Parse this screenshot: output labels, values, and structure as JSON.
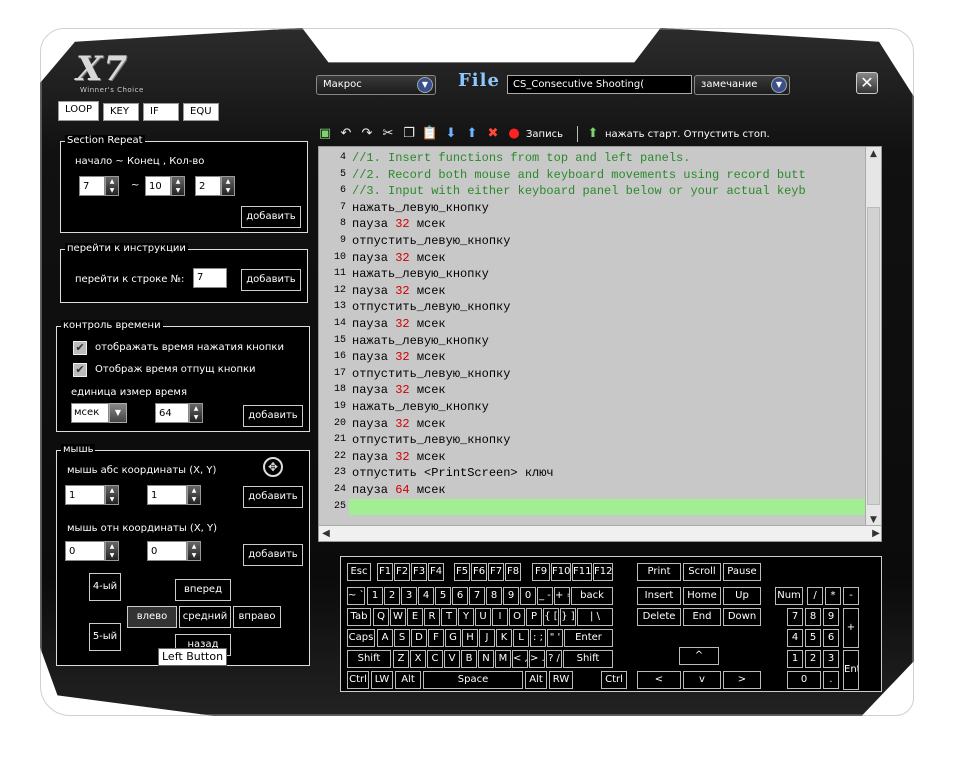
{
  "logo": {
    "mark": "X7",
    "sub": "Winner's Choice"
  },
  "top": {
    "mode_select": "Макрос",
    "file_label": "File",
    "file_name": "CS_Consecutive Shooting(",
    "delay_select": "замечание",
    "close": "✕"
  },
  "tabs": [
    "LOOP",
    "KEY",
    "IF",
    "EQU"
  ],
  "section_repeat": {
    "title": "Section Repeat",
    "hint": "начало ~ Конец , Кол-во",
    "start": "7",
    "tilde": "~",
    "end": "10",
    "count": "2",
    "add": "добавить"
  },
  "goto": {
    "title": "перейти к инструкции",
    "label": "перейти к строке №:",
    "value": "7",
    "add": "добавить"
  },
  "time_control": {
    "title": "контроль времени",
    "opt1": "отображать время нажатия кнопки",
    "opt2": "Отображ время отпущ кнопки",
    "unit_label": "единица измер",
    "time_label": "время",
    "unit": "мсек",
    "time": "64",
    "add": "добавить"
  },
  "mouse": {
    "title": "мышь",
    "abs_label": "мышь абс координаты (X, Y)",
    "abs_x": "1",
    "abs_y": "1",
    "rel_label": "мышь отн координаты (X, Y)",
    "rel_x": "0",
    "rel_y": "0",
    "add": "добавить",
    "btn4": "4-ый",
    "btn5": "5-ый",
    "forward": "вперед",
    "left": "влево",
    "middle": "средний",
    "right": "вправо",
    "back": "назад",
    "tooltip": "Left Button"
  },
  "toolbar": {
    "record": "Запись",
    "hint": "нажать старт. Отпустить стоп."
  },
  "editor": {
    "lines": [
      {
        "num": "4",
        "code": "//1. Insert functions from top and left panels.",
        "type": "comment"
      },
      {
        "num": "5",
        "code": "//2. Record both mouse and keyboard movements using record butt",
        "type": "comment"
      },
      {
        "num": "6",
        "code": "//3. Input with either keyboard panel below or your actual keyb",
        "type": "comment"
      },
      {
        "num": "7",
        "code": "нажать_левую_кнопку",
        "type": "cmd"
      },
      {
        "num": "8",
        "pre": "пауза ",
        "n": "32",
        "post": " мсек",
        "type": "pause"
      },
      {
        "num": "9",
        "code": "отпустить_левую_кнопку",
        "type": "cmd"
      },
      {
        "num": "10",
        "pre": "пауза ",
        "n": "32",
        "post": " мсек",
        "type": "pause"
      },
      {
        "num": "11",
        "code": "нажать_левую_кнопку",
        "type": "cmd"
      },
      {
        "num": "12",
        "pre": "пауза ",
        "n": "32",
        "post": " мсек",
        "type": "pause"
      },
      {
        "num": "13",
        "code": "отпустить_левую_кнопку",
        "type": "cmd"
      },
      {
        "num": "14",
        "pre": "пауза ",
        "n": "32",
        "post": " мсек",
        "type": "pause"
      },
      {
        "num": "15",
        "code": "нажать_левую_кнопку",
        "type": "cmd"
      },
      {
        "num": "16",
        "pre": "пауза ",
        "n": "32",
        "post": " мсек",
        "type": "pause"
      },
      {
        "num": "17",
        "code": "отпустить_левую_кнопку",
        "type": "cmd"
      },
      {
        "num": "18",
        "pre": "пауза ",
        "n": "32",
        "post": " мсек",
        "type": "pause"
      },
      {
        "num": "19",
        "code": "нажать_левую_кнопку",
        "type": "cmd"
      },
      {
        "num": "20",
        "pre": "пауза ",
        "n": "32",
        "post": " мсек",
        "type": "pause"
      },
      {
        "num": "21",
        "code": "отпустить_левую_кнопку",
        "type": "cmd"
      },
      {
        "num": "22",
        "pre": "пауза ",
        "n": "32",
        "post": " мсек",
        "type": "pause"
      },
      {
        "num": "23",
        "code": "отпустить <PrintScreen> ключ",
        "type": "cmd"
      },
      {
        "num": "24",
        "pre": "пауза ",
        "n": "64",
        "post": " мсек",
        "type": "pause"
      },
      {
        "num": "25",
        "code": "",
        "type": "current"
      }
    ]
  },
  "keyboard": {
    "keys": [
      {
        "l": "Esc"
      },
      {
        "l": "F1"
      },
      {
        "l": "F2"
      },
      {
        "l": "F3"
      },
      {
        "l": "F4"
      },
      {
        "l": "F5"
      },
      {
        "l": "F6"
      },
      {
        "l": "F7"
      },
      {
        "l": "F8"
      },
      {
        "l": "F9"
      },
      {
        "l": "F10"
      },
      {
        "l": "F11"
      },
      {
        "l": "F12"
      },
      {
        "l": "Print"
      },
      {
        "l": "Scroll"
      },
      {
        "l": "Pause"
      },
      {
        "l": "~ `"
      },
      {
        "l": "1"
      },
      {
        "l": "2"
      },
      {
        "l": "3"
      },
      {
        "l": "4"
      },
      {
        "l": "5"
      },
      {
        "l": "6"
      },
      {
        "l": "7"
      },
      {
        "l": "8"
      },
      {
        "l": "9"
      },
      {
        "l": "0"
      },
      {
        "l": "_ -"
      },
      {
        "l": "+ ="
      },
      {
        "l": "back"
      },
      {
        "l": "Insert"
      },
      {
        "l": "Home"
      },
      {
        "l": "Up"
      },
      {
        "l": "Num"
      },
      {
        "l": "/"
      },
      {
        "l": "*"
      },
      {
        "l": "-"
      },
      {
        "l": "Tab"
      },
      {
        "l": "Q"
      },
      {
        "l": "W"
      },
      {
        "l": "E"
      },
      {
        "l": "R"
      },
      {
        "l": "T"
      },
      {
        "l": "Y"
      },
      {
        "l": "U"
      },
      {
        "l": "I"
      },
      {
        "l": "O"
      },
      {
        "l": "P"
      },
      {
        "l": "{ ["
      },
      {
        "l": "} ]"
      },
      {
        "l": "| \\"
      },
      {
        "l": "Delete"
      },
      {
        "l": "End"
      },
      {
        "l": "Down"
      },
      {
        "l": "7"
      },
      {
        "l": "8"
      },
      {
        "l": "9"
      },
      {
        "l": "+"
      },
      {
        "l": "Caps"
      },
      {
        "l": "A"
      },
      {
        "l": "S"
      },
      {
        "l": "D"
      },
      {
        "l": "F"
      },
      {
        "l": "G"
      },
      {
        "l": "H"
      },
      {
        "l": "J"
      },
      {
        "l": "K"
      },
      {
        "l": "L"
      },
      {
        "l": ": ;"
      },
      {
        "l": "\" '"
      },
      {
        "l": "Enter"
      },
      {
        "l": "4"
      },
      {
        "l": "5"
      },
      {
        "l": "6"
      },
      {
        "l": "Shift"
      },
      {
        "l": "Z"
      },
      {
        "l": "X"
      },
      {
        "l": "C"
      },
      {
        "l": "V"
      },
      {
        "l": "B"
      },
      {
        "l": "N"
      },
      {
        "l": "M"
      },
      {
        "l": "< ,"
      },
      {
        "l": "> ."
      },
      {
        "l": "? /"
      },
      {
        "l": "Shift"
      },
      {
        "l": "^"
      },
      {
        "l": "1"
      },
      {
        "l": "2"
      },
      {
        "l": "3"
      },
      {
        "l": "Enter"
      },
      {
        "l": "Ctrl"
      },
      {
        "l": "LW"
      },
      {
        "l": "Alt"
      },
      {
        "l": "Space"
      },
      {
        "l": "Alt"
      },
      {
        "l": "RW"
      },
      {
        "l": "Ctrl"
      },
      {
        "l": "<"
      },
      {
        "l": "v"
      },
      {
        "l": ">"
      },
      {
        "l": "0"
      },
      {
        "l": "."
      }
    ]
  },
  "colors": {
    "comment": "#2a8a2a",
    "number": "#d00000",
    "current_line": "#a2ee92",
    "editor_bg": "#c8c8c8"
  }
}
